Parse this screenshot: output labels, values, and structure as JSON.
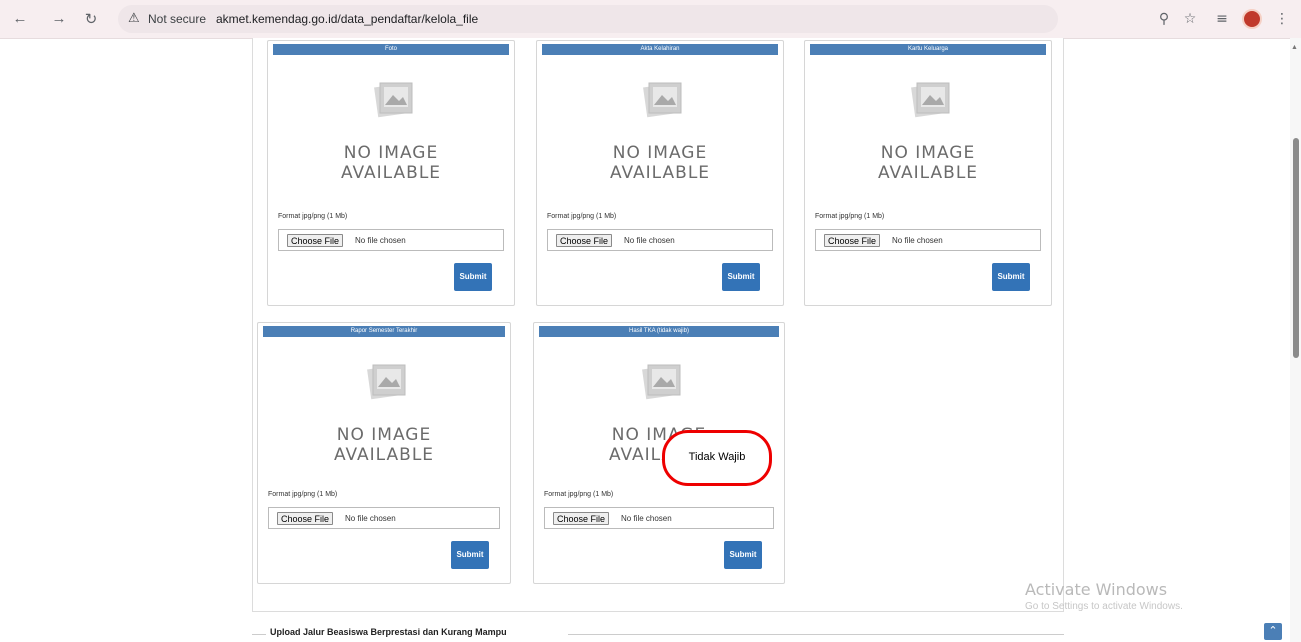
{
  "browser": {
    "security_label": "Not secure",
    "url": "akmet.kemendag.go.id/data_pendaftar/kelola_file"
  },
  "icons": {
    "back": "arrow-left-icon",
    "forward": "arrow-right-icon",
    "reload": "reload-icon",
    "warning": "warning-triangle-icon",
    "zoom": "zoom-icon",
    "bookmark": "star-icon",
    "reading_list": "reading-list-icon",
    "menu": "kebab-menu-icon"
  },
  "upload_cards": [
    {
      "title": "Foto",
      "no_image_line1": "NO IMAGE",
      "no_image_line2": "AVAILABLE",
      "format_label": "Format jpg/png (1 Mb)",
      "choose_label": "Choose File",
      "file_status": "No file chosen",
      "submit_label": "Submit"
    },
    {
      "title": "Akta Kelahiran",
      "no_image_line1": "NO IMAGE",
      "no_image_line2": "AVAILABLE",
      "format_label": "Format jpg/png (1 Mb)",
      "choose_label": "Choose File",
      "file_status": "No file chosen",
      "submit_label": "Submit"
    },
    {
      "title": "Kartu Keluarga",
      "no_image_line1": "NO IMAGE",
      "no_image_line2": "AVAILABLE",
      "format_label": "Format jpg/png (1 Mb)",
      "choose_label": "Choose File",
      "file_status": "No file chosen",
      "submit_label": "Submit"
    },
    {
      "title": "Rapor Semester Terakhir",
      "no_image_line1": "NO IMAGE",
      "no_image_line2": "AVAILABLE",
      "format_label": "Format jpg/png (1 Mb)",
      "choose_label": "Choose File",
      "file_status": "No file chosen",
      "submit_label": "Submit"
    },
    {
      "title": "Hasil TKA (tidak wajib)",
      "no_image_line1": "NO IMAGE",
      "no_image_line2": "AVAILABLE",
      "format_label": "Format jpg/png (1 Mb)",
      "choose_label": "Choose File",
      "file_status": "No file chosen",
      "submit_label": "Submit"
    }
  ],
  "annotation": {
    "label": "Tidak Wajib",
    "color": "#e00000"
  },
  "next_section": {
    "title": "Upload Jalur Beasiswa Berprestasi dan Kurang Mampu"
  },
  "watermark": {
    "line1": "Activate Windows",
    "line2": "Go to Settings to activate Windows."
  },
  "colors": {
    "card_header": "#4b7fb6",
    "submit_button": "#3373b7",
    "browser_bar": "#f7eef0"
  }
}
